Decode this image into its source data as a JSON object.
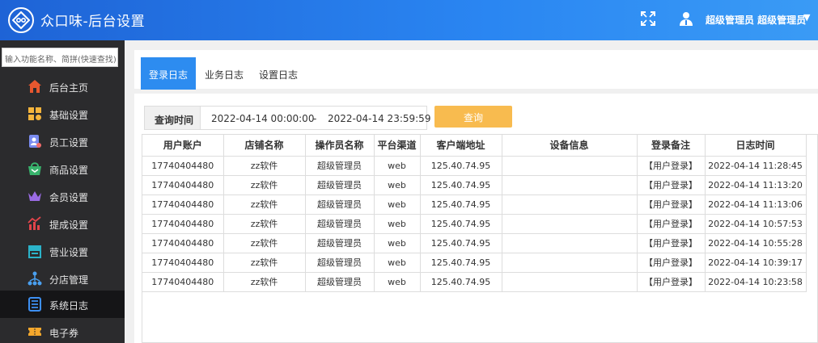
{
  "header": {
    "app_title": "众口味-后台设置",
    "user_name": "超级管理员 超级管理员",
    "caret": "▼"
  },
  "sidebar": {
    "search_placeholder": "输入功能名称、简拼(快速查找)",
    "items": [
      {
        "label": "后台主页",
        "icon": "home-icon",
        "color": "#e8572f"
      },
      {
        "label": "基础设置",
        "icon": "basic-settings-icon",
        "color": "#f4b43c"
      },
      {
        "label": "员工设置",
        "icon": "staff-icon",
        "color": "#7b8cf0"
      },
      {
        "label": "商品设置",
        "icon": "goods-icon",
        "color": "#38b36c"
      },
      {
        "label": "会员设置",
        "icon": "crown-icon",
        "color": "#9a6be3"
      },
      {
        "label": "提成设置",
        "icon": "commission-chart-icon",
        "color": "#e2444a"
      },
      {
        "label": "营业设置",
        "icon": "store-icon",
        "color": "#2bb3c9"
      },
      {
        "label": "分店管理",
        "icon": "branch-tree-icon",
        "color": "#4aa0f0"
      },
      {
        "label": "系统日志",
        "icon": "log-list-icon",
        "color": "#3d8ff2"
      },
      {
        "label": "电子券",
        "icon": "ticket-icon",
        "color": "#f4a72c"
      }
    ]
  },
  "tabs": [
    {
      "label": "登录日志"
    },
    {
      "label": "业务日志"
    },
    {
      "label": "设置日志"
    }
  ],
  "query": {
    "label": "查询时间",
    "start": "2022-04-14 00:00:00",
    "separator": "-",
    "end": "2022-04-14 23:59:59",
    "button": "查询"
  },
  "table": {
    "columns": [
      "用户账户",
      "店铺名称",
      "操作员名称",
      "平台渠道",
      "客户端地址",
      "设备信息",
      "登录备注",
      "日志时间"
    ],
    "rows": [
      [
        "17740404480",
        "zz软件",
        "超级管理员",
        "web",
        "125.40.74.95",
        "",
        "【用户登录】",
        "2022-04-14 11:28:45"
      ],
      [
        "17740404480",
        "zz软件",
        "超级管理员",
        "web",
        "125.40.74.95",
        "",
        "【用户登录】",
        "2022-04-14 11:13:20"
      ],
      [
        "17740404480",
        "zz软件",
        "超级管理员",
        "web",
        "125.40.74.95",
        "",
        "【用户登录】",
        "2022-04-14 11:13:06"
      ],
      [
        "17740404480",
        "zz软件",
        "超级管理员",
        "web",
        "125.40.74.95",
        "",
        "【用户登录】",
        "2022-04-14 10:57:53"
      ],
      [
        "17740404480",
        "zz软件",
        "超级管理员",
        "web",
        "125.40.74.95",
        "",
        "【用户登录】",
        "2022-04-14 10:55:28"
      ],
      [
        "17740404480",
        "zz软件",
        "超级管理员",
        "web",
        "125.40.74.95",
        "",
        "【用户登录】",
        "2022-04-14 10:39:17"
      ],
      [
        "17740404480",
        "zz软件",
        "超级管理员",
        "web",
        "125.40.74.95",
        "",
        "【用户登录】",
        "2022-04-14 10:23:58"
      ]
    ]
  },
  "colors": {
    "header_start": "#1e63d6",
    "header_end": "#3a9bf5",
    "sidebar_bg": "#2b2b2d",
    "active_tab": "#2d8cf0",
    "query_button": "#f8bb4f"
  }
}
